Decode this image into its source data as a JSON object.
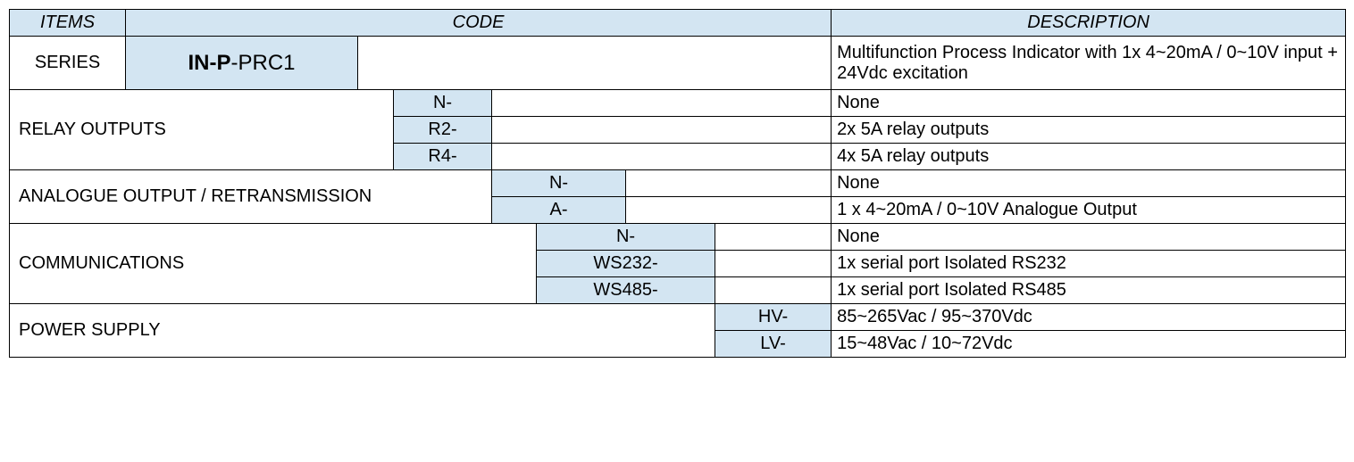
{
  "headers": {
    "items": "ITEMS",
    "code": "CODE",
    "description": "DESCRIPTION"
  },
  "series": {
    "label": "SERIES",
    "code_bold1": "IN-P",
    "code_light": "-PRC1",
    "description": "Multifunction Process Indicator with 1x 4~20mA / 0~10V input + 24Vdc excitation"
  },
  "relay": {
    "label": "RELAY OUTPUTS",
    "options": [
      {
        "code": "N-",
        "desc": "None"
      },
      {
        "code": "R2-",
        "desc": "2x 5A relay outputs"
      },
      {
        "code": "R4-",
        "desc": "4x 5A relay outputs"
      }
    ]
  },
  "analogue": {
    "label": "ANALOGUE OUTPUT / RETRANSMISSION",
    "options": [
      {
        "code": "N-",
        "desc": "None"
      },
      {
        "code": "A-",
        "desc": "1 x 4~20mA / 0~10V Analogue Output"
      }
    ]
  },
  "comms": {
    "label": "COMMUNICATIONS",
    "options": [
      {
        "code": "N-",
        "desc": "None"
      },
      {
        "code": "WS232-",
        "desc": "1x serial port Isolated RS232"
      },
      {
        "code": "WS485-",
        "desc": "1x serial port Isolated RS485"
      }
    ]
  },
  "power": {
    "label": "POWER SUPPLY",
    "options": [
      {
        "code": "HV-",
        "desc": "85~265Vac / 95~370Vdc"
      },
      {
        "code": "LV-",
        "desc": "15~48Vac / 10~72Vdc"
      }
    ]
  }
}
